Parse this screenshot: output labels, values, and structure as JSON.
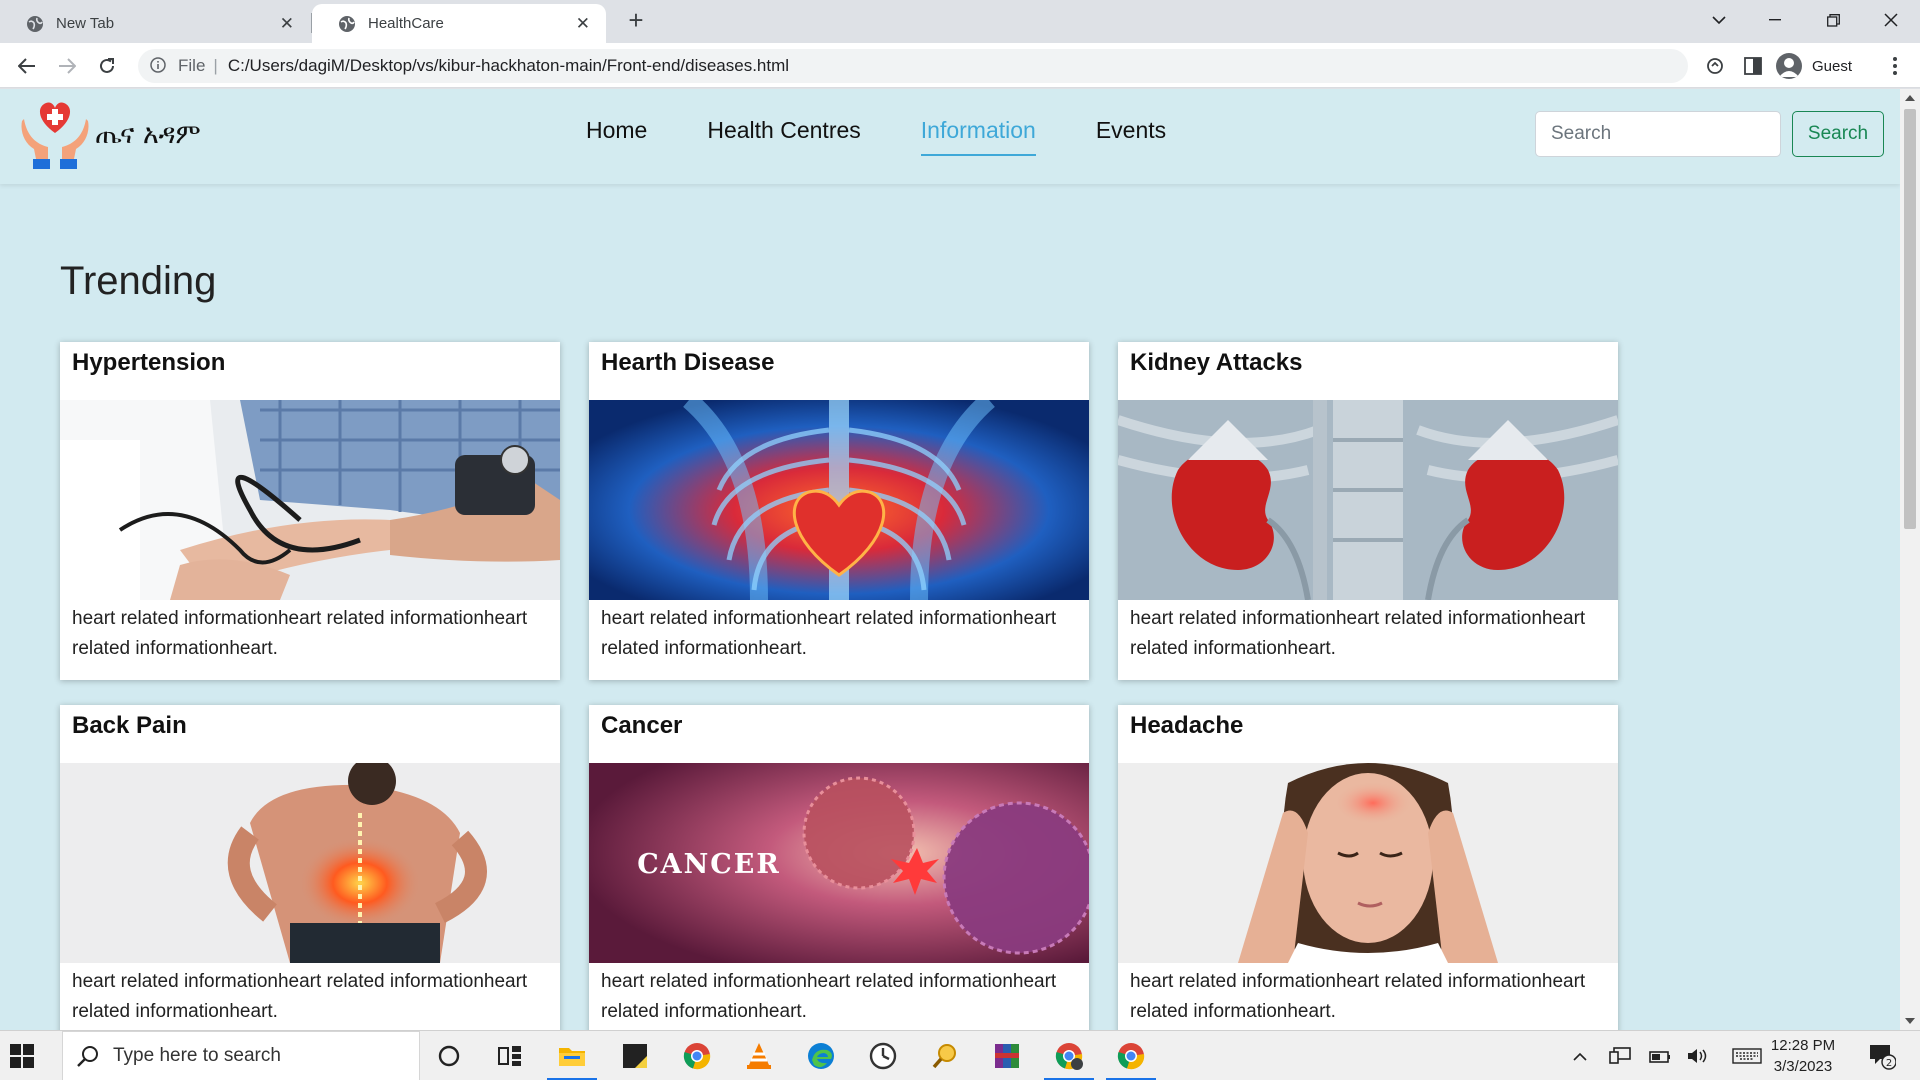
{
  "browser": {
    "tabs": [
      {
        "title": "New Tab",
        "active": false
      },
      {
        "title": "HealthCare",
        "active": true
      }
    ],
    "address": {
      "scheme_label": "File",
      "url": "C:/Users/dagiM/Desktop/vs/kibur-hackhaton-main/Front-end/diseases.html"
    },
    "profile_label": "Guest"
  },
  "site": {
    "brand": "ጤና አዳም",
    "nav": [
      "Home",
      "Health Centres",
      "Information",
      "Events"
    ],
    "active_nav": "Information",
    "search": {
      "placeholder": "Search",
      "button": "Search"
    },
    "section_title": "Trending",
    "cards": [
      {
        "title": "Hypertension",
        "text": "heart related informationheart related informationheart related informationheart."
      },
      {
        "title": "Hearth Disease",
        "text": "heart related informationheart related informationheart related informationheart."
      },
      {
        "title": "Kidney Attacks",
        "text": "heart related informationheart related informationheart related informationheart."
      },
      {
        "title": "Back Pain",
        "text": "heart related informationheart related informationheart related informationheart."
      },
      {
        "title": "Cancer",
        "image_caption": "CANCER",
        "text": "heart related informationheart related informationheart related informationheart."
      },
      {
        "title": "Headache",
        "text": "heart related informationheart related informationheart related informationheart."
      }
    ]
  },
  "taskbar": {
    "search_placeholder": "Type here to search",
    "time": "12:28 PM",
    "date": "3/3/2023",
    "notification_count": "2"
  },
  "colors": {
    "page_bg": "#d2eaf0",
    "nav_active": "#3ea8d8",
    "search_button": "#198754"
  }
}
